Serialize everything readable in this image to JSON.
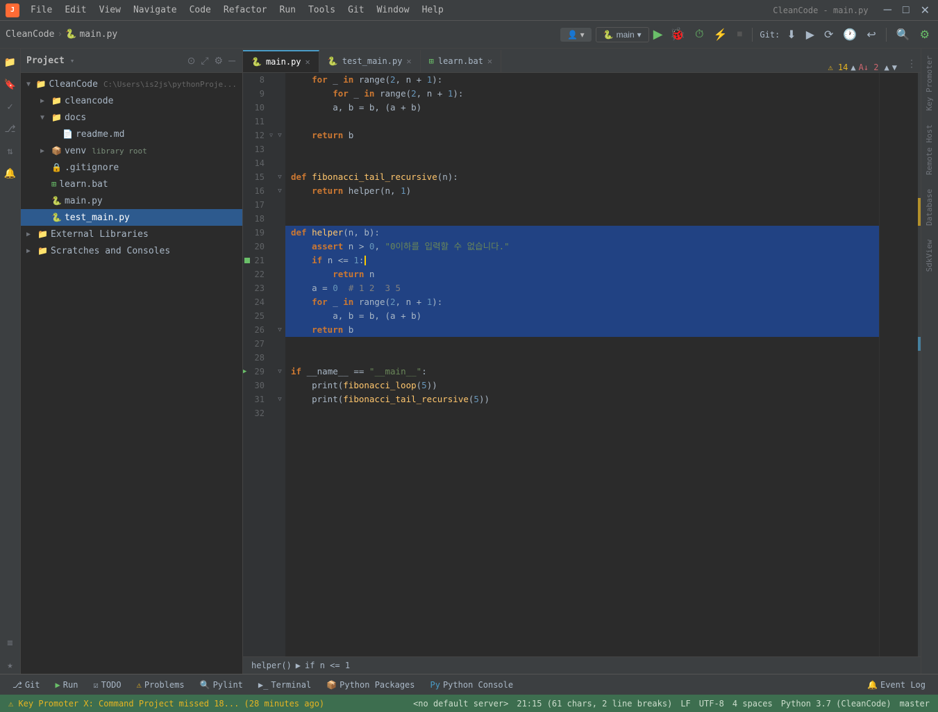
{
  "app": {
    "icon": "J",
    "title": "CleanCode - main.py"
  },
  "menu": {
    "items": [
      "File",
      "Edit",
      "View",
      "Navigate",
      "Code",
      "Refactor",
      "Run",
      "Tools",
      "Git",
      "Window",
      "Help"
    ]
  },
  "toolbar": {
    "breadcrumb_project": "CleanCode",
    "breadcrumb_file": "main.py",
    "user_btn": "👤",
    "branch": "main",
    "run_btn": "▶",
    "git_label": "Git:",
    "warning_count": "⚠ 14",
    "error_count": "A↓ 2"
  },
  "project_panel": {
    "title": "Project",
    "root": "CleanCode",
    "root_path": "C:\\Users\\is2js\\pythonProje...",
    "items": [
      {
        "id": "cleancode",
        "label": "cleancode",
        "type": "folder",
        "depth": 1,
        "expanded": false
      },
      {
        "id": "docs",
        "label": "docs",
        "type": "folder",
        "depth": 1,
        "expanded": true
      },
      {
        "id": "readme",
        "label": "readme.md",
        "type": "md",
        "depth": 2
      },
      {
        "id": "venv",
        "label": "venv",
        "type": "venv",
        "depth": 1,
        "expanded": false,
        "tag": "library root"
      },
      {
        "id": "gitignore",
        "label": ".gitignore",
        "type": "file",
        "depth": 1
      },
      {
        "id": "learnbat",
        "label": "learn.bat",
        "type": "bat",
        "depth": 1
      },
      {
        "id": "mainpy",
        "label": "main.py",
        "type": "py",
        "depth": 1
      },
      {
        "id": "testmainpy",
        "label": "test_main.py",
        "type": "py",
        "depth": 1,
        "selected": true
      },
      {
        "id": "extlibs",
        "label": "External Libraries",
        "type": "folder",
        "depth": 0,
        "expanded": false
      },
      {
        "id": "scratches",
        "label": "Scratches and Consoles",
        "type": "folder",
        "depth": 0,
        "expanded": false
      }
    ]
  },
  "tabs": [
    {
      "id": "main-py",
      "label": "main.py",
      "type": "py",
      "active": true
    },
    {
      "id": "test-main-py",
      "label": "test_main.py",
      "type": "py",
      "active": false
    },
    {
      "id": "learn-bat",
      "label": "learn.bat",
      "type": "bat",
      "active": false
    }
  ],
  "code": {
    "lines": [
      {
        "num": 8,
        "content": "    for _ in range(2, n + 1):"
      },
      {
        "num": 9,
        "content": "        for _ in range(2, n + 1):"
      },
      {
        "num": 10,
        "content": "        a, b = b, (a + b)"
      },
      {
        "num": 11,
        "content": ""
      },
      {
        "num": 12,
        "content": "    return b",
        "fold": true
      },
      {
        "num": 13,
        "content": ""
      },
      {
        "num": 14,
        "content": ""
      },
      {
        "num": 15,
        "content": "def fibonacci_tail_recursive(n):",
        "fold": true
      },
      {
        "num": 16,
        "content": "    return helper(n, 1)",
        "fold": true
      },
      {
        "num": 17,
        "content": ""
      },
      {
        "num": 18,
        "content": ""
      },
      {
        "num": 19,
        "content": "def helper(n, b):",
        "highlighted": true
      },
      {
        "num": 20,
        "content": "    assert n > 0, \"0이하를 입력할 수 없습니다.\"",
        "highlighted": true
      },
      {
        "num": 21,
        "content": "    if n <= 1:",
        "highlighted": true,
        "cursor": true
      },
      {
        "num": 22,
        "content": "        return n",
        "highlighted": true
      },
      {
        "num": 23,
        "content": "    a = 0  # 1 2  3 5",
        "highlighted": true
      },
      {
        "num": 24,
        "content": "    for _ in range(2, n + 1):",
        "highlighted": true
      },
      {
        "num": 25,
        "content": "        a, b = b, (a + b)",
        "highlighted": true
      },
      {
        "num": 26,
        "content": "    return b",
        "highlighted": true,
        "fold": true
      },
      {
        "num": 27,
        "content": ""
      },
      {
        "num": 28,
        "content": ""
      },
      {
        "num": 29,
        "content": "if __name__ == \"__main__\":",
        "run": true,
        "fold": true
      },
      {
        "num": 30,
        "content": "    print(fibonacci_loop(5))"
      },
      {
        "num": 31,
        "content": "    print(fibonacci_tail_recursive(5))",
        "fold": true
      },
      {
        "num": 32,
        "content": ""
      }
    ]
  },
  "breadcrumb_code": {
    "items": [
      "helper()",
      "▶",
      "if n <= 1"
    ]
  },
  "bottom_tabs": [
    {
      "label": "Git",
      "icon": "⎇"
    },
    {
      "label": "Run",
      "icon": "▶"
    },
    {
      "label": "TODO",
      "icon": "☑"
    },
    {
      "label": "Problems",
      "icon": "⚠"
    },
    {
      "label": "Pylint",
      "icon": "🔍"
    },
    {
      "label": "Terminal",
      "icon": ">_"
    },
    {
      "label": "Python Packages",
      "icon": "📦"
    },
    {
      "label": "Python Console",
      "icon": "Py"
    },
    {
      "label": "Event Log",
      "icon": "📋"
    }
  ],
  "status_bar": {
    "warning": "⚠ Key Promoter X: Command Project missed 18... (28 minutes ago)",
    "server": "<no default server>",
    "position": "21:15 (61 chars, 2 line breaks)",
    "line_ending": "LF",
    "encoding": "UTF-8",
    "indent": "4 spaces",
    "python": "Python 3.7 (CleanCode)",
    "branch": "master"
  },
  "right_sidebar": {
    "labels": [
      "Key Promoter",
      "Remote Host",
      "Database",
      "SdkView"
    ]
  }
}
